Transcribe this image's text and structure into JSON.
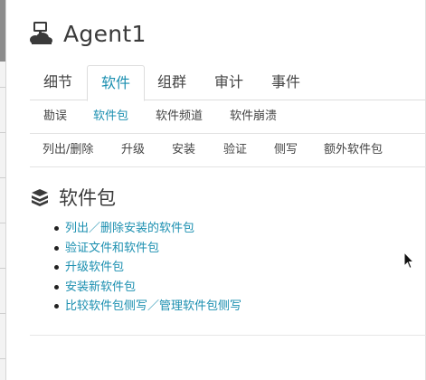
{
  "header": {
    "title": "Agent1",
    "icon": "server-cloud-icon"
  },
  "tabs": [
    {
      "label": "细节",
      "active": false
    },
    {
      "label": "软件",
      "active": true
    },
    {
      "label": "组群",
      "active": false
    },
    {
      "label": "审计",
      "active": false
    },
    {
      "label": "事件",
      "active": false
    }
  ],
  "subtabs": [
    {
      "label": "勘误",
      "active": false
    },
    {
      "label": "软件包",
      "active": true
    },
    {
      "label": "软件频道",
      "active": false
    },
    {
      "label": "软件崩溃",
      "active": false
    }
  ],
  "actions": [
    {
      "label": "列出/删除"
    },
    {
      "label": "升级"
    },
    {
      "label": "安装"
    },
    {
      "label": "验证"
    },
    {
      "label": "侧写"
    },
    {
      "label": "额外软件包"
    }
  ],
  "section": {
    "title": "软件包",
    "icon": "packages-icon"
  },
  "links": [
    {
      "label": "列出／删除安装的软件包"
    },
    {
      "label": "验证文件和软件包"
    },
    {
      "label": "升级软件包"
    },
    {
      "label": "安装新软件包"
    },
    {
      "label": "比较软件包侧写／管理软件包侧写"
    }
  ],
  "colors": {
    "accent": "#1b8fb0",
    "text": "#444444",
    "border": "#dddddd"
  }
}
